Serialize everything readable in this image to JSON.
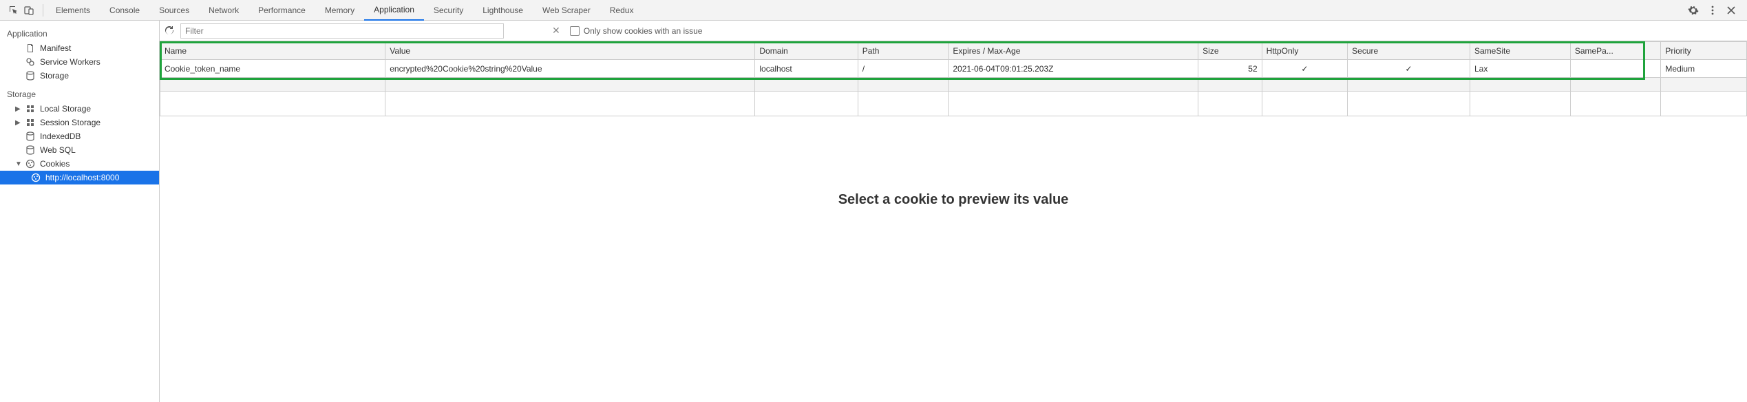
{
  "tabs": [
    "Elements",
    "Console",
    "Sources",
    "Network",
    "Performance",
    "Memory",
    "Application",
    "Security",
    "Lighthouse",
    "Web Scraper",
    "Redux"
  ],
  "activeTab": "Application",
  "filter": {
    "placeholder": "Filter"
  },
  "toolbar": {
    "only_issue_label": "Only show cookies with an issue"
  },
  "sidebar": {
    "app_title": "Application",
    "app_items": [
      "Manifest",
      "Service Workers",
      "Storage"
    ],
    "storage_title": "Storage",
    "storage_items": [
      "Local Storage",
      "Session Storage",
      "IndexedDB",
      "Web SQL",
      "Cookies"
    ],
    "cookies_selected": "http://localhost:8000"
  },
  "columns": [
    "Name",
    "Value",
    "Domain",
    "Path",
    "Expires / Max-Age",
    "Size",
    "HttpOnly",
    "Secure",
    "SameSite",
    "SamePa...",
    "Priority"
  ],
  "rows": [
    {
      "name": "Cookie_token_name",
      "value": "encrypted%20Cookie%20string%20Value",
      "domain": "localhost",
      "path": "/",
      "expires": "2021-06-04T09:01:25.203Z",
      "size": "52",
      "http": "✓",
      "secure": "✓",
      "samesite": "Lax",
      "samepa": "",
      "priority": "Medium"
    }
  ],
  "preview_text": "Select a cookie to preview its value"
}
